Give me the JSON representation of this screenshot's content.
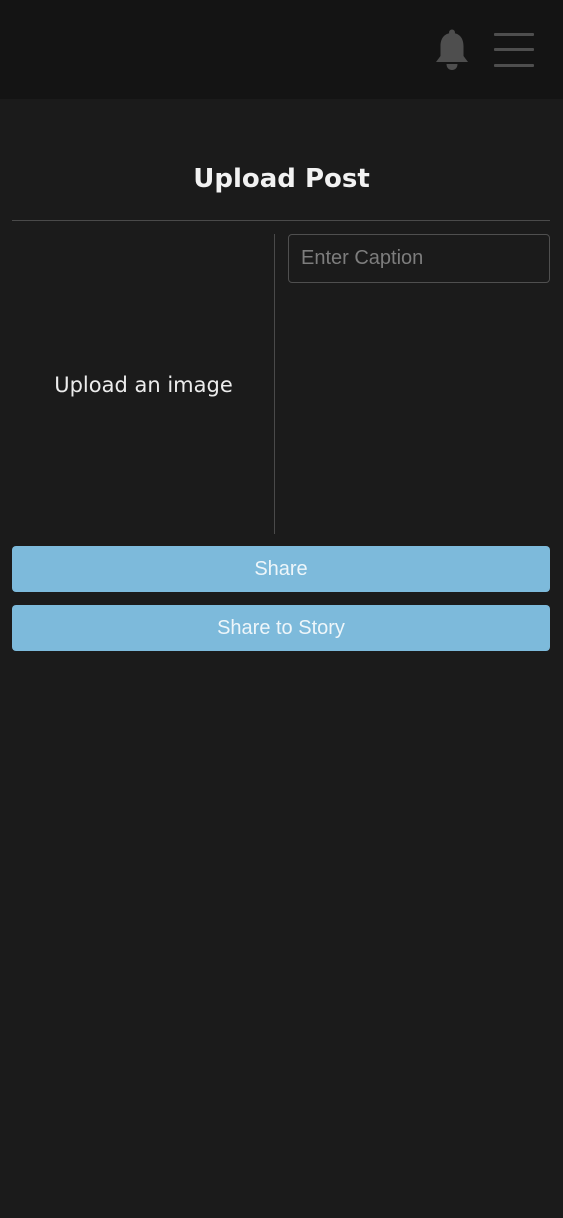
{
  "header": {
    "notification_icon": "bell-icon",
    "menu_icon": "hamburger-menu-icon"
  },
  "page": {
    "title": "Upload Post"
  },
  "upload": {
    "label": "Upload an image"
  },
  "caption": {
    "placeholder": "Enter Caption",
    "value": ""
  },
  "actions": {
    "share_label": "Share",
    "share_story_label": "Share to Story"
  },
  "colors": {
    "background": "#1b1b1b",
    "header_background": "#141414",
    "accent": "#7dbadb",
    "icon": "#4e4e4e"
  }
}
